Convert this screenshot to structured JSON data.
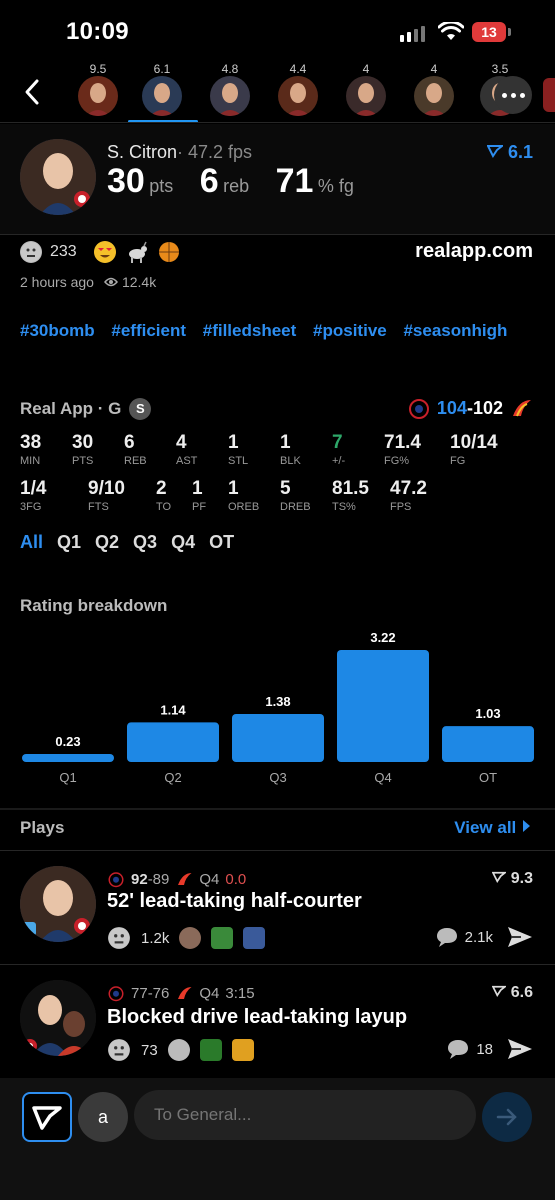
{
  "status_bar": {
    "time": "10:09",
    "battery": "13"
  },
  "top_nav": {
    "players": [
      {
        "rating": "9.5",
        "color": "#6a2a1a"
      },
      {
        "rating": "6.1",
        "color": "#2a3a55"
      },
      {
        "rating": "4.8",
        "color": "#3a3a4a"
      },
      {
        "rating": "4.4",
        "color": "#5a2a1a"
      },
      {
        "rating": "4",
        "color": "#3a2a2a"
      },
      {
        "rating": "4",
        "color": "#4a3a2a"
      },
      {
        "rating": "3.5",
        "color": "#333"
      }
    ]
  },
  "header": {
    "name": "S. Citron",
    "fps": "· 47.2 fps",
    "rating": "6.1",
    "pts": "30",
    "pts_unit": "pts",
    "reb": "6",
    "reb_unit": "reb",
    "fg": "71",
    "fg_unit": "% fg"
  },
  "reactions": {
    "count": "233",
    "time_ago": "2 hours ago",
    "views": "12.4k",
    "site": "realapp.com"
  },
  "hashtags": [
    "#30bomb",
    "#efficient",
    "#filledsheet",
    "#positive",
    "#seasonhigh"
  ],
  "game": {
    "title": "Real App · G",
    "badge": "S",
    "score_home": "104",
    "score_away": "-102",
    "stats_row1": [
      {
        "v": "38",
        "l": "MIN"
      },
      {
        "v": "30",
        "l": "PTS"
      },
      {
        "v": "6",
        "l": "REB"
      },
      {
        "v": "4",
        "l": "AST"
      },
      {
        "v": "1",
        "l": "STL"
      },
      {
        "v": "1",
        "l": "BLK"
      },
      {
        "v": "7",
        "l": "+/-"
      },
      {
        "v": "71.4",
        "l": "FG%"
      },
      {
        "v": "10/14",
        "l": "FG"
      }
    ],
    "stats_row2": [
      {
        "v": "1/4",
        "l": "3FG"
      },
      {
        "v": "9/10",
        "l": "FTS"
      },
      {
        "v": "2",
        "l": "TO"
      },
      {
        "v": "1",
        "l": "PF"
      },
      {
        "v": "1",
        "l": "OREB"
      },
      {
        "v": "5",
        "l": "DREB"
      },
      {
        "v": "81.5",
        "l": "TS%"
      },
      {
        "v": "47.2",
        "l": "FPS"
      }
    ],
    "plusminus_color": "#2ea86a"
  },
  "quarter_tabs": [
    "All",
    "Q1",
    "Q2",
    "Q3",
    "Q4",
    "OT"
  ],
  "rating_breakdown": {
    "title": "Rating breakdown"
  },
  "chart_data": {
    "type": "bar",
    "categories": [
      "Q1",
      "Q2",
      "Q3",
      "Q4",
      "OT"
    ],
    "values": [
      0.23,
      1.14,
      1.38,
      3.22,
      1.03
    ],
    "value_labels": [
      "0.23",
      "1.14",
      "1.38",
      "3.22",
      "1.03"
    ],
    "color": "#1e88e5"
  },
  "plays": {
    "title": "Plays",
    "view_all": "View all",
    "items": [
      {
        "score_home": "92",
        "score_away": "-89",
        "period": "Q4",
        "clock": "0.0",
        "clock_color": "#e05050",
        "rating": "9.3",
        "title": "52' lead-taking half-courter",
        "reactions": "1.2k",
        "comments": "2.1k"
      },
      {
        "score_home": "77",
        "score_away": "-76",
        "period": "Q4",
        "clock": "3:15",
        "clock_color": "#aaaaaa",
        "rating": "6.6",
        "title": "Blocked drive lead-taking layup",
        "reactions": "73",
        "comments": "18"
      }
    ]
  },
  "composer": {
    "avatar_letter": "a",
    "placeholder": "To General..."
  }
}
